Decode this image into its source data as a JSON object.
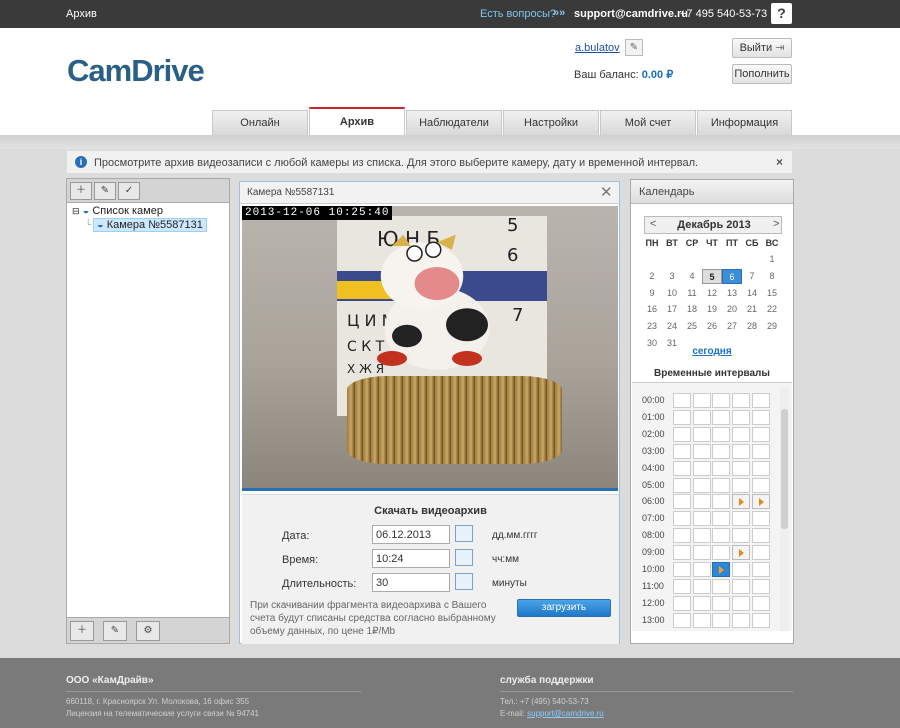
{
  "topbar": {
    "section": "Архив",
    "question": "Есть вопросы?",
    "arrows": "»»",
    "email": "support@camdrive.ru",
    "phone": "+7 495 540-53-73",
    "help": "?"
  },
  "header": {
    "logo": "CamDrive",
    "username": "a.bulatov",
    "balance_label": "Ваш баланс:",
    "balance_value": "0.00 ₽",
    "logout_label": "Выйти",
    "topup_label": "Пополнить"
  },
  "tabs": [
    {
      "label": "Онлайн"
    },
    {
      "label": "Архив"
    },
    {
      "label": "Наблюдатели"
    },
    {
      "label": "Настройки"
    },
    {
      "label": "Мой счет"
    },
    {
      "label": "Информация"
    }
  ],
  "notice": {
    "text": "Просмотрите архив видеозаписи с любой камеры из списка. Для этого выберите камеру, дату и временной интервал.",
    "close": "×"
  },
  "tree": {
    "root": "Список камер",
    "camera": "Камера №5587131"
  },
  "viewer": {
    "title": "Камера №5587131",
    "close": "✕",
    "timestamp": "2013-12-06 10:25:40"
  },
  "download": {
    "heading": "Скачать видеоархив",
    "date_label": "Дата:",
    "date_value": "06.12.2013",
    "date_unit": "дд.мм.гггг",
    "time_label": "Время:",
    "time_value": "10:24",
    "time_unit": "чч:мм",
    "duration_label": "Длительность:",
    "duration_value": "30",
    "duration_unit": "минуты",
    "note": "При скачивании фрагмента видеоархива с Вашего счета будут списаны средства согласно выбранному объему данных, по цене 1₽/Mb",
    "button": "загрузить"
  },
  "calendar": {
    "header": "Календарь",
    "prev": "<",
    "next": ">",
    "month": "Декабрь 2013",
    "weekdays": [
      "ПН",
      "ВТ",
      "СР",
      "ЧТ",
      "ПТ",
      "СБ",
      "ВС"
    ],
    "weeks": [
      [
        "",
        "",
        "",
        "",
        "",
        "",
        "1"
      ],
      [
        "2",
        "3",
        "4",
        "5",
        "6",
        "7",
        "8"
      ],
      [
        "9",
        "10",
        "11",
        "12",
        "13",
        "14",
        "15"
      ],
      [
        "16",
        "17",
        "18",
        "19",
        "20",
        "21",
        "22"
      ],
      [
        "23",
        "24",
        "25",
        "26",
        "27",
        "28",
        "29"
      ],
      [
        "30",
        "31",
        "",
        "",
        "",
        "",
        ""
      ]
    ],
    "today_link": "сегодня",
    "intervals_title": "Временные интервалы"
  },
  "intervals": {
    "hours": [
      "00:00",
      "01:00",
      "02:00",
      "03:00",
      "04:00",
      "05:00",
      "06:00",
      "07:00",
      "08:00",
      "09:00",
      "10:00",
      "11:00",
      "12:00",
      "13:00"
    ],
    "marked": [
      {
        "hour": "06:00",
        "slots": [
          3,
          4
        ],
        "style": "arrow"
      },
      {
        "hour": "09:00",
        "slots": [
          3
        ],
        "style": "arrow"
      },
      {
        "hour": "10:00",
        "slots": [
          2
        ],
        "style": "blue"
      }
    ]
  },
  "footer": {
    "company": "ООО «КамДрайв»",
    "address": "660118, г. Красноярск Ул. Молокова, 16 офис 355",
    "license": "Лицензия на телематические услуги связи № 94741",
    "support": "служба поддержки",
    "support_phone": "Тел.: +7 (495) 540-53-73",
    "support_email_label": "E-mail:",
    "support_email": "support@camdrive.ru"
  }
}
